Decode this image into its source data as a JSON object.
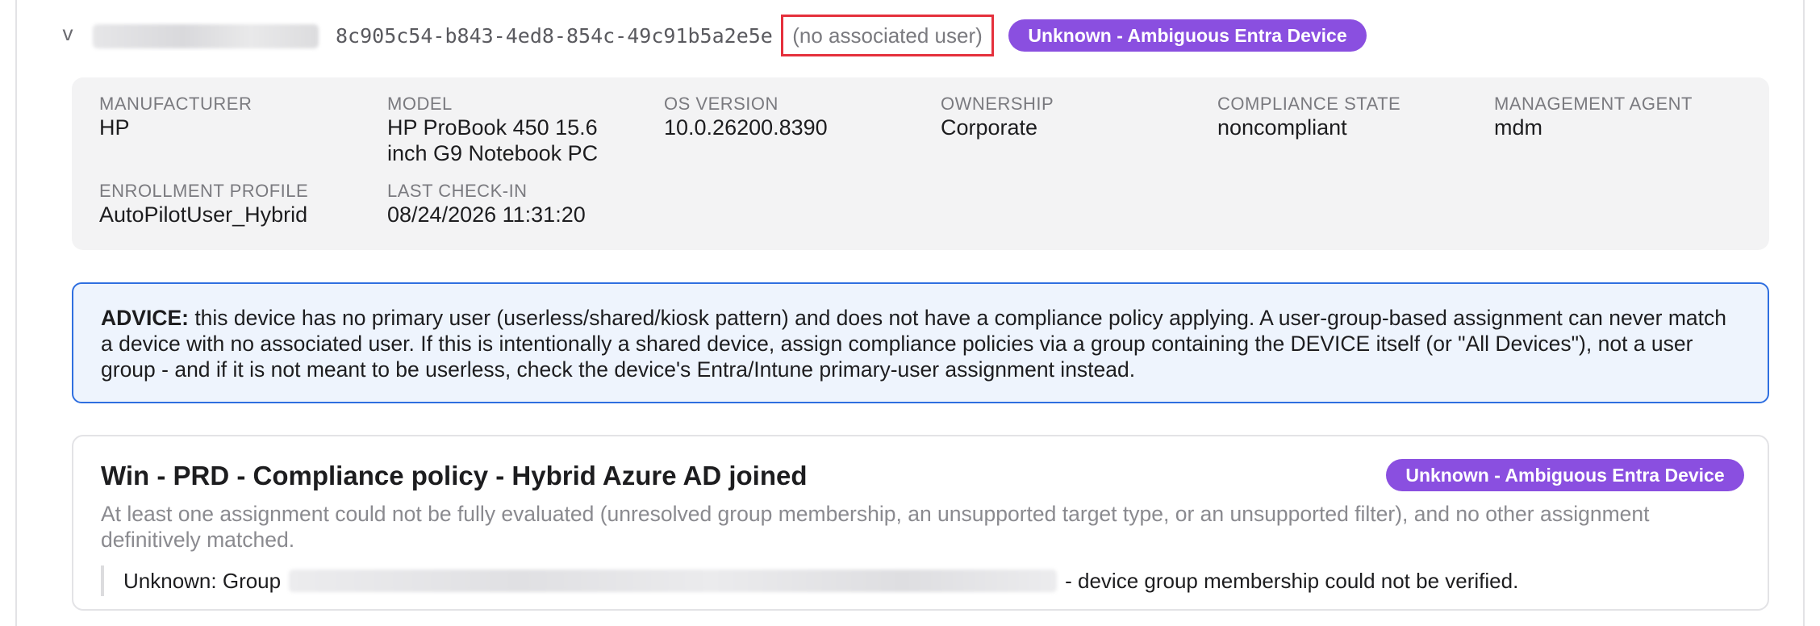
{
  "device": {
    "chevron": "v",
    "id": "8c905c54-b843-4ed8-854c-49c91b5a2e5e",
    "associated_user": "(no associated user)",
    "status_badge": "Unknown - Ambiguous Entra Device"
  },
  "properties": [
    {
      "label": "MANUFACTURER",
      "value": "HP"
    },
    {
      "label": "MODEL",
      "value": "HP ProBook 450 15.6 inch G9 Notebook PC"
    },
    {
      "label": "OS VERSION",
      "value": "10.0.26200.8390"
    },
    {
      "label": "OWNERSHIP",
      "value": "Corporate"
    },
    {
      "label": "COMPLIANCE STATE",
      "value": "noncompliant"
    },
    {
      "label": "MANAGEMENT AGENT",
      "value": "mdm"
    },
    {
      "label": "ENROLLMENT PROFILE",
      "value": "AutoPilotUser_Hybrid"
    },
    {
      "label": "LAST CHECK-IN",
      "value": "08/24/2026 11:31:20"
    }
  ],
  "advice": {
    "prefix": "ADVICE:",
    "text": " this device has no primary user (userless/shared/kiosk pattern) and does not have a compliance policy applying. A user-group-based assignment can never match a device with no associated user. If this is intentionally a shared device, assign compliance policies via a group containing the DEVICE itself (or \"All Devices\"), not a user group - and if it is not meant to be userless, check the device's Entra/Intune primary-user assignment instead."
  },
  "policy": {
    "title": "Win - PRD - Compliance policy - Hybrid Azure AD joined",
    "badge": "Unknown - Ambiguous Entra Device",
    "description": "At least one assignment could not be fully evaluated (unresolved group membership, an unsupported target type, or an unsupported filter), and no other assignment definitively matched.",
    "detail_prefix": "Unknown: Group",
    "detail_suffix": "- device group membership could not be verified."
  },
  "colors": {
    "badge": "#8a4fe0",
    "highlight_border": "#e5303c",
    "advice_border": "#2f6fe0",
    "advice_bg": "#eef4fd"
  }
}
